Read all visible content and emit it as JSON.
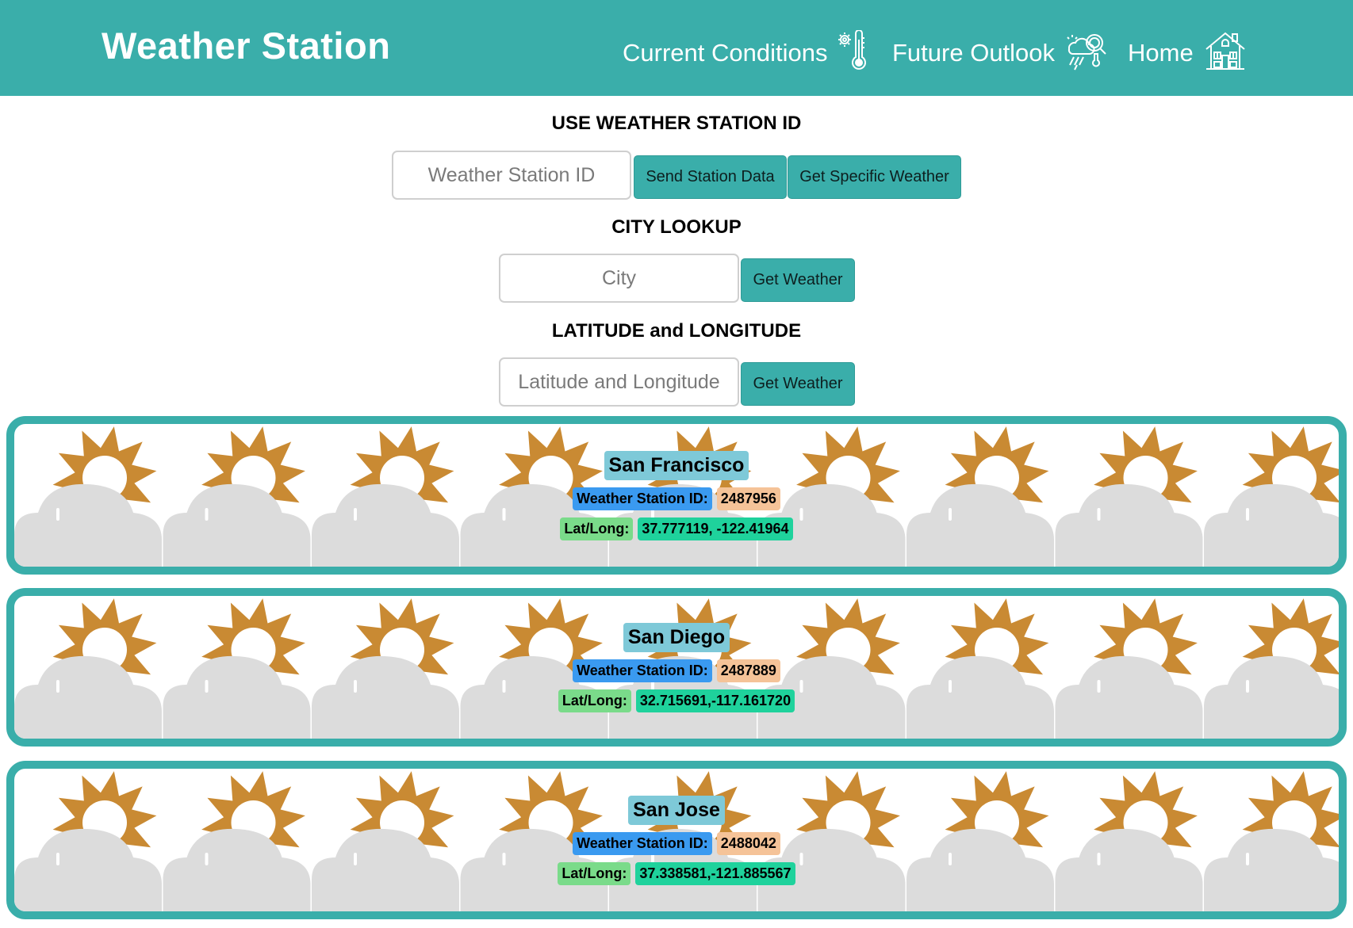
{
  "header": {
    "title": "Weather Station",
    "nav": [
      {
        "label": "Current Conditions",
        "icon": "thermometer-icon"
      },
      {
        "label": "Future Outlook",
        "icon": "weather-outlook-icon"
      },
      {
        "label": "Home",
        "icon": "house-icon"
      }
    ]
  },
  "station_search": {
    "heading": "USE WEATHER STATION ID",
    "placeholder": "Weather Station ID",
    "send_button": "Send Station Data",
    "get_button": "Get Specific Weather"
  },
  "city_search": {
    "heading": "CITY LOOKUP",
    "placeholder": "City",
    "button": "Get Weather"
  },
  "latlong_search": {
    "heading": "LATITUDE and LONGITUDE",
    "placeholder": "Latitude and Longitude",
    "button": "Get Weather"
  },
  "labels": {
    "station_id": "Weather Station ID:",
    "lat_long": "Lat/Long:"
  },
  "stations": [
    {
      "city": "San Francisco",
      "station_id": "2487956",
      "lat_long": "37.777119, -122.41964"
    },
    {
      "city": "San Diego",
      "station_id": "2487889",
      "lat_long": "32.715691,-117.161720"
    },
    {
      "city": "San Jose",
      "station_id": "2488042",
      "lat_long": "37.338581,-121.885567"
    }
  ],
  "colors": {
    "brand": "#3aaeaa",
    "sun": "#c98a33",
    "cloud": "#dcdcdc",
    "station_id_label": "#3a9af0",
    "station_id_value": "#f5c398",
    "lat_long_label": "#7adb8a",
    "lat_long_value": "#1fd29c"
  },
  "card_background_icon": "partly-cloudy-icon"
}
